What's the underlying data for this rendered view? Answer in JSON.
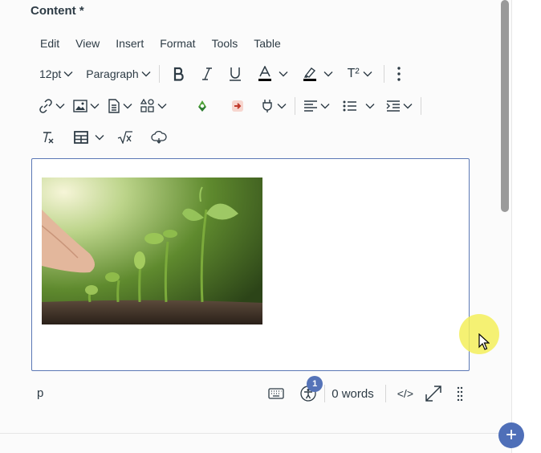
{
  "field": {
    "label": "Content *"
  },
  "menubar": {
    "items": [
      "Edit",
      "View",
      "Insert",
      "Format",
      "Tools",
      "Table"
    ]
  },
  "toolbar": {
    "font_size": "12pt",
    "block_format": "Paragraph",
    "superscript_label": "T²"
  },
  "statusbar": {
    "path": "p",
    "a11y_badge_count": "1",
    "word_count": "0 words",
    "html_editor_label": "</>"
  },
  "fab": {
    "label": "+"
  },
  "colors": {
    "accent": "#5573b8",
    "editor_border": "#5b78b5",
    "text_color_bar": "#000000",
    "highlight_bar": "#000000"
  },
  "icons": [
    "bold-icon",
    "italic-icon",
    "underline-icon",
    "text-color-icon",
    "highlight-icon",
    "superscript-icon",
    "more-icon",
    "link-icon",
    "image-icon",
    "document-icon",
    "apps-icon",
    "recycle-icon",
    "arrow-icon",
    "plug-icon",
    "align-icon",
    "bullet-list-icon",
    "indent-icon",
    "clear-format-icon",
    "table-icon",
    "math-icon",
    "cloud-icon",
    "keyboard-icon",
    "accessibility-icon",
    "fullscreen-icon",
    "drag-handle-icon"
  ]
}
